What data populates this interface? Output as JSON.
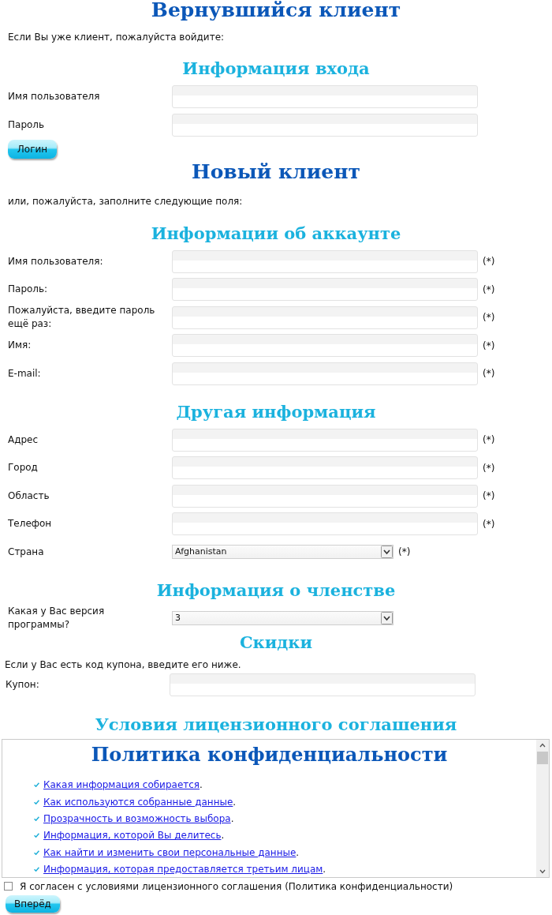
{
  "returning_customer": {
    "title": "Вернувшийся клиент",
    "intro": "Если Вы уже клиент, пожалуйста войдите:",
    "section_title": "Информация входа",
    "fields": [
      {
        "label": "Имя пользователя",
        "kind": "text"
      },
      {
        "label": "Пароль",
        "kind": "text"
      }
    ],
    "button": "Логин"
  },
  "new_customer": {
    "title": "Новый клиент",
    "intro": "или, пожалуйста, заполните следующие поля:"
  },
  "sections": [
    {
      "title": "Информации об аккаунте",
      "fields": [
        {
          "label": "Имя пользователя:",
          "kind": "text",
          "required": "(*)"
        },
        {
          "label": "Пароль:",
          "kind": "text",
          "required": "(*)"
        },
        {
          "label": "Пожалуйста, введите пароль ещё раз:",
          "kind": "text",
          "required": "(*)"
        },
        {
          "label": "Имя:",
          "kind": "text",
          "required": "(*)"
        },
        {
          "label": "E-mail:",
          "kind": "text",
          "required": "(*)"
        }
      ]
    },
    {
      "title": "Другая информация",
      "fields": [
        {
          "label": "Адрес",
          "kind": "text",
          "required": "(*)"
        },
        {
          "label": "Город",
          "kind": "text",
          "required": "(*)"
        },
        {
          "label": "Область",
          "kind": "text",
          "required": "(*)"
        },
        {
          "label": "Телефон",
          "kind": "text",
          "required": "(*)"
        },
        {
          "label": "Страна",
          "kind": "select",
          "value": "Afghanistan",
          "required": "(*)"
        }
      ]
    },
    {
      "title": "Информация о членстве",
      "fields": [
        {
          "label": "Какая у Вас версия программы?",
          "kind": "select",
          "value": "3"
        }
      ]
    },
    {
      "title": "Скидки",
      "intro": "Если у Вас есть код купона, введите его ниже.",
      "fields": [
        {
          "label": "Купон:",
          "kind": "text"
        }
      ]
    }
  ],
  "terms": {
    "title": "Условия лицензионного соглашения",
    "document": {
      "heading": "Политика конфиденциальности",
      "items": [
        {
          "link": "Какая информация собирается",
          "tail": "."
        },
        {
          "link": "Как используются собранные данные",
          "tail": "."
        },
        {
          "link": "Прозрачность и возможность выбора",
          "tail": "."
        },
        {
          "link": "Информация, которой Вы делитесь",
          "tail": "."
        },
        {
          "link": "Как найти и изменить свои персональные данные",
          "tail": "."
        },
        {
          "link": "Информация, которая предоставляется третьим лицам",
          "tail": "."
        }
      ]
    },
    "agree": {
      "label": "Я согласен с условиями лицензионного соглашения (Политика конфиденциальности)",
      "checked": false
    },
    "button": "Вперёд"
  }
}
